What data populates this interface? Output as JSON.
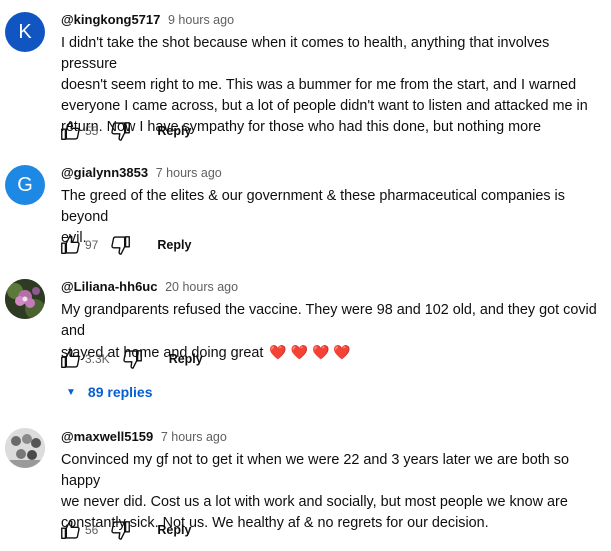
{
  "comments": [
    {
      "avatar_letter": "K",
      "avatar_color": "#1155c2",
      "author": "@kingkong5717",
      "time": "9 hours ago",
      "lines": [
        "I didn't take the shot because when it comes to health, anything that involves pressure",
        "doesn't seem right to me. This was a bummer for me from the start, and I warned",
        "everyone I came across, but a lot of people didn't want to listen and attacked me in",
        "return. Now I have sympathy for those who had this done, but nothing more"
      ],
      "likes": "55",
      "reply_label": "Reply"
    },
    {
      "avatar_letter": "G",
      "avatar_color": "#1e88e5",
      "author": "@gialynn3853",
      "time": "7 hours ago",
      "lines": [
        "The greed of the elites & our government & these pharmaceutical companies is beyond",
        "evil."
      ],
      "likes": "97",
      "reply_label": "Reply"
    },
    {
      "author": "@Liliana-hh6uc",
      "time": "20 hours ago",
      "lines": [
        "My grandparents refused the vaccine. They were 98 and 102 old, and they got covid and",
        "stayed at home and doing great"
      ],
      "hearts": "❤️ ❤️ ❤️ ❤️",
      "likes": "3.3K",
      "reply_label": "Reply",
      "replies_label": "89 replies"
    },
    {
      "author": "@maxwell5159",
      "time": "7 hours ago",
      "lines": [
        "Convinced my gf not to get it when we were 22 and 3 years later we are both so happy",
        "we never did. Cost us a lot with work and socially, but most people we know are",
        "constantly sick. Not us. We healthy af & no regrets for our decision."
      ],
      "likes": "56",
      "reply_label": "Reply"
    }
  ]
}
